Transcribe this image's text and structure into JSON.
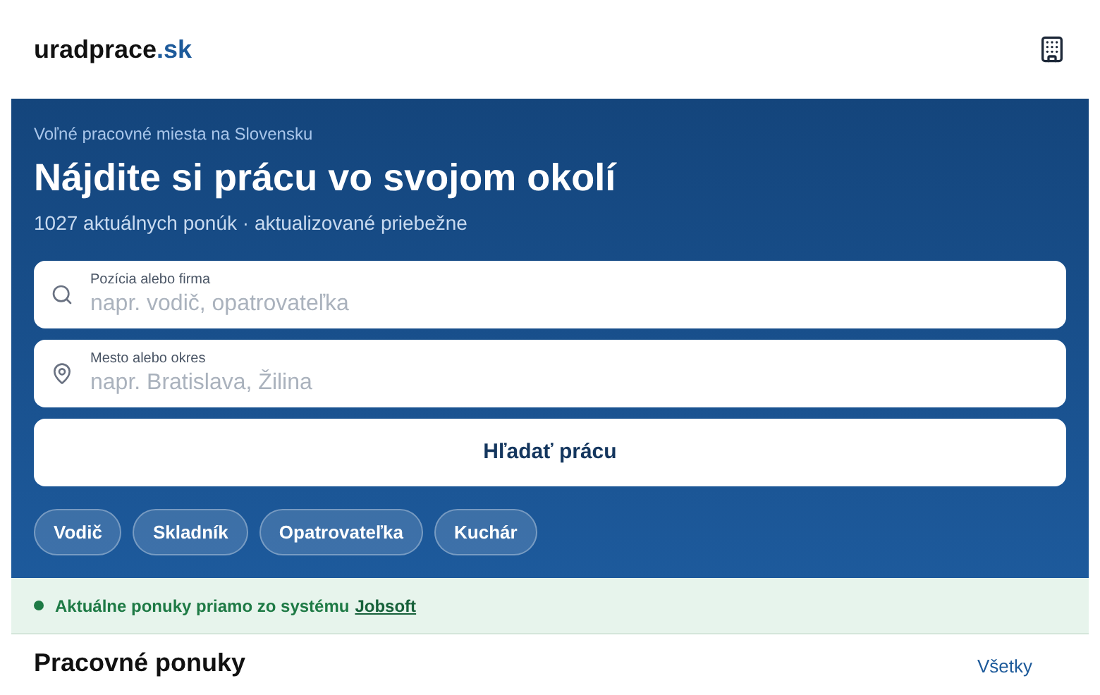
{
  "header": {
    "logo_main": "uradprace",
    "logo_suffix": ".sk"
  },
  "hero": {
    "eyebrow": "Voľné pracovné miesta na Slovensku",
    "title": "Nájdite si prácu vo svojom okolí",
    "subtitle": "1027 aktuálnych ponúk · aktualizované priebežne",
    "fields": [
      {
        "kind": "search",
        "label": "Pozícia alebo firma",
        "placeholder": "napr. vodič, opatrovateľka"
      },
      {
        "kind": "location",
        "label": "Mesto alebo okres",
        "placeholder": "napr. Bratislava, Žilina"
      }
    ],
    "button": "Hľadať prácu",
    "chips": [
      "Vodič",
      "Skladník",
      "Opatrovateľka",
      "Kuchár"
    ]
  },
  "notice": {
    "text": "Aktuálne ponuky priamo zo systému",
    "link": "Jobsoft"
  },
  "section": {
    "title": "Pracovné ponuky",
    "link": "Všetky"
  }
}
